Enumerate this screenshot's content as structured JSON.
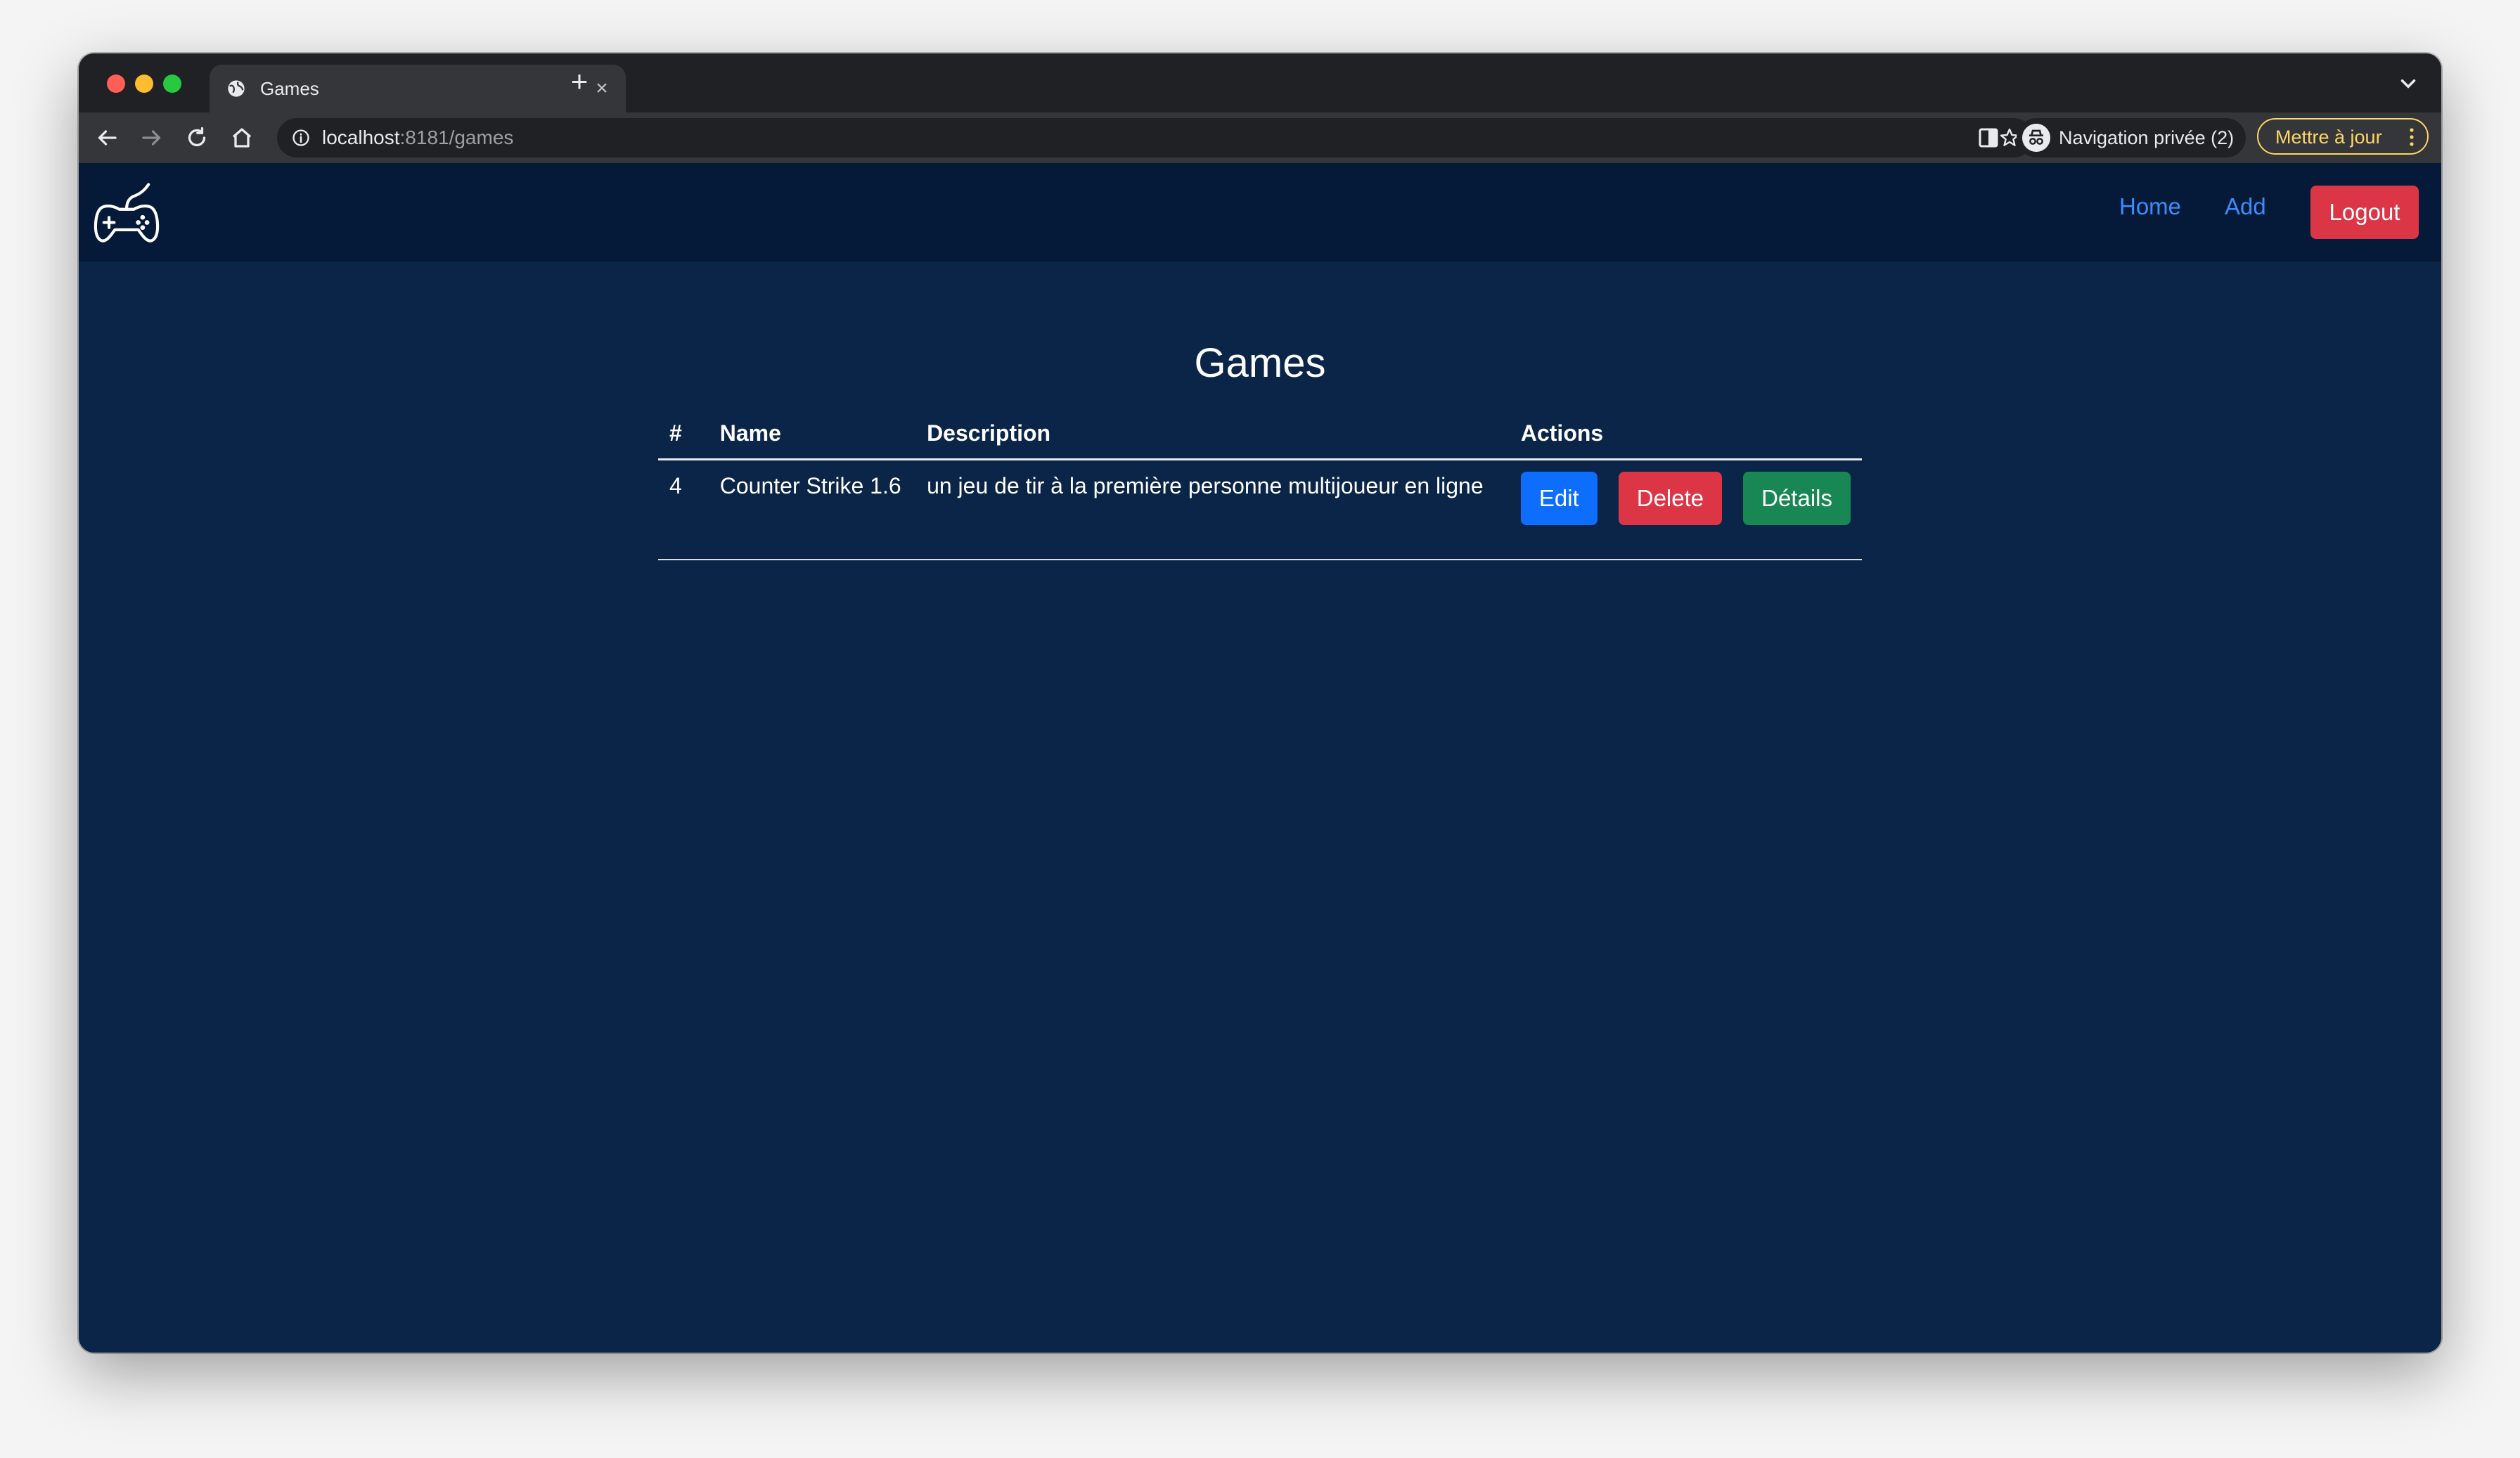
{
  "browser": {
    "tab": {
      "title": "Games",
      "close_glyph": "×",
      "icon": "globe-icon"
    },
    "new_tab_glyph": "+",
    "address": {
      "host": "localhost",
      "rest": ":8181/games"
    },
    "profile_label": "Navigation privée (2)",
    "update_label": "Mettre à jour"
  },
  "navbar": {
    "logo": "gamepad-icon",
    "links": {
      "home": "Home",
      "add": "Add"
    },
    "logout": "Logout"
  },
  "main": {
    "title": "Games",
    "table": {
      "headers": [
        "#",
        "Name",
        "Description",
        "Actions"
      ],
      "rows": [
        {
          "id": "4",
          "name": "Counter Strike 1.6",
          "description": "un jeu de tir à la première personne multijoueur en ligne",
          "actions": {
            "edit": "Edit",
            "delete": "Delete",
            "details": "Détails"
          }
        }
      ]
    }
  },
  "colors": {
    "page_bg": "#0a2547",
    "navbar_bg": "#051a38",
    "link": "#3d8bfd",
    "primary": "#0d6efd",
    "danger": "#dc3545",
    "success": "#198754"
  }
}
